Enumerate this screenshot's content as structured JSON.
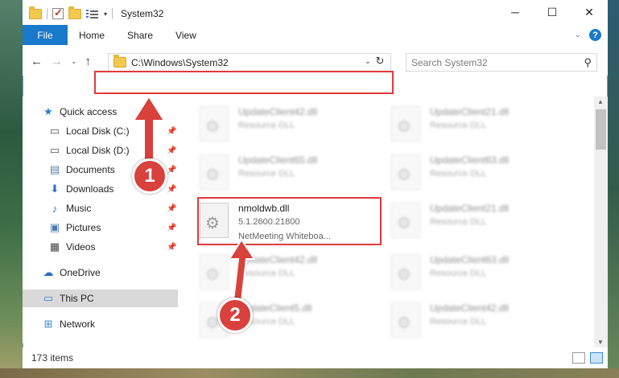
{
  "window": {
    "title": "System32",
    "controls": [
      "─",
      "☐",
      "✕"
    ]
  },
  "ribbon": {
    "tabs": [
      "File",
      "Home",
      "Share",
      "View"
    ],
    "help": "?"
  },
  "address_bar": {
    "path": "C:\\Windows\\System32",
    "search_placeholder": "Search System32"
  },
  "nav_pane": {
    "items": [
      {
        "label": "Quick access",
        "icon": "star-icon",
        "pinned": false
      },
      {
        "label": "Local Disk (C:)",
        "icon": "drive-icon",
        "pinned": true
      },
      {
        "label": "Local Disk (D:)",
        "icon": "drive-icon",
        "pinned": true
      },
      {
        "label": "Documents",
        "icon": "documents-icon",
        "pinned": true
      },
      {
        "label": "Downloads",
        "icon": "download-icon",
        "pinned": true
      },
      {
        "label": "Music",
        "icon": "music-icon",
        "pinned": true
      },
      {
        "label": "Pictures",
        "icon": "pictures-icon",
        "pinned": true
      },
      {
        "label": "Videos",
        "icon": "videos-icon",
        "pinned": true
      },
      {
        "label": "OneDrive",
        "icon": "cloud-icon",
        "pinned": false
      },
      {
        "label": "This PC",
        "icon": "computer-icon",
        "pinned": false,
        "selected": true
      },
      {
        "label": "Network",
        "icon": "network-icon",
        "pinned": false
      }
    ]
  },
  "files": {
    "left": [
      {
        "name": "UpdateClient42.dll",
        "desc": "Resource DLL"
      },
      {
        "name": "UpdateClient65.dll",
        "desc": "Resource DLL"
      },
      {
        "name": "nmoldwb.dll",
        "version": "5.1.2600.21800",
        "desc": "NetMeeting Whiteboa..."
      },
      {
        "name": "UpdateClient42.dll",
        "desc": "Resource DLL"
      },
      {
        "name": "UpdateClient5.dll",
        "desc": "Resource DLL"
      }
    ],
    "right": [
      {
        "name": "UpdateClient21.dll",
        "desc": "Resource DLL"
      },
      {
        "name": "UpdateClient63.dll",
        "desc": "Resource DLL"
      },
      {
        "name": "UpdateClient21.dll",
        "desc": "Resource DLL"
      },
      {
        "name": "UpdateClient63.dll",
        "desc": "Resource DLL"
      },
      {
        "name": "UpdateClient42.dll",
        "desc": "Resource DLL"
      }
    ]
  },
  "status": {
    "item_count": "173 items"
  },
  "callouts": [
    "1",
    "2"
  ],
  "colors": {
    "accent": "#1979ca",
    "highlight": "#e03a3a",
    "callout": "#d9413d"
  }
}
